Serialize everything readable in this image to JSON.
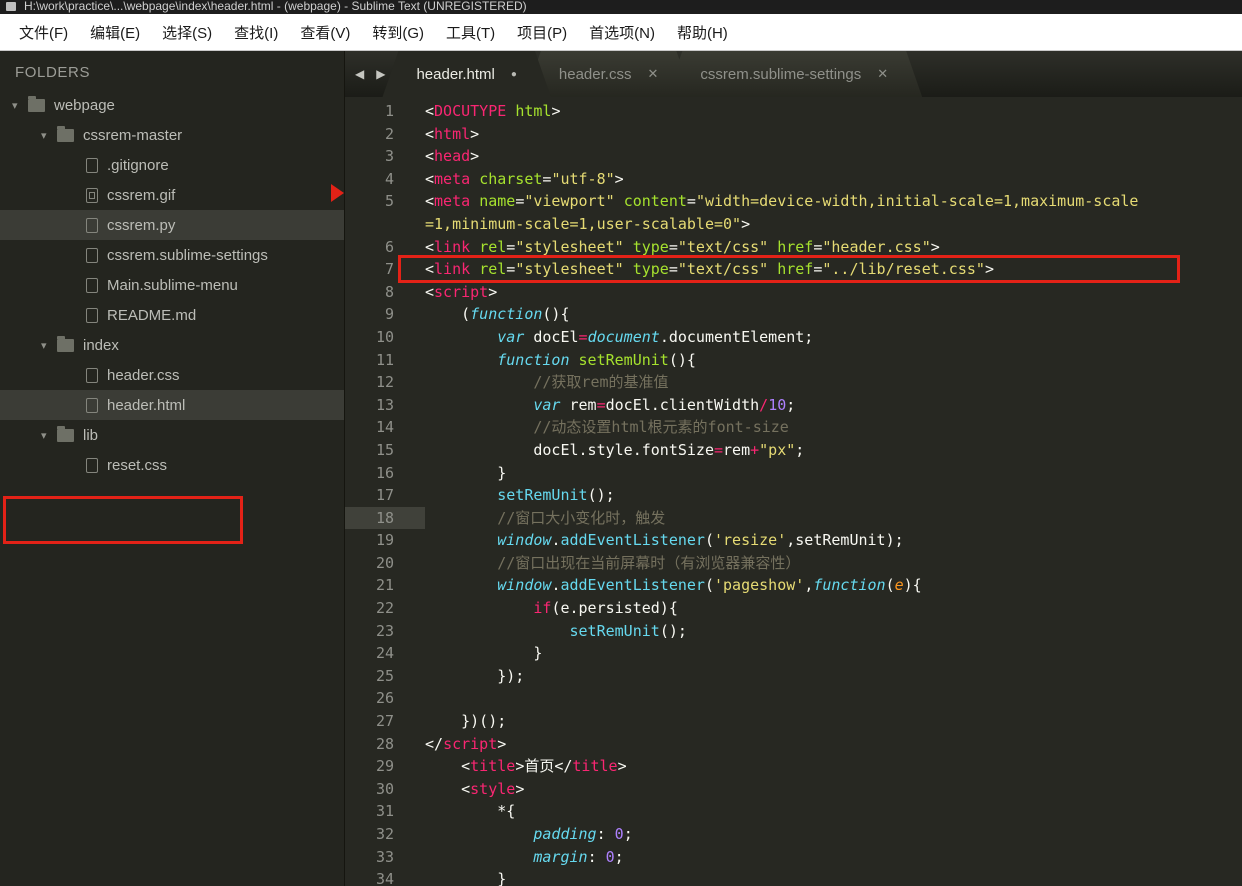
{
  "title_bar": {
    "title": "H:\\work\\practice\\...\\webpage\\index\\header.html - (webpage) - Sublime Text (UNREGISTERED)"
  },
  "menu": {
    "items": [
      "文件(F)",
      "编辑(E)",
      "选择(S)",
      "查找(I)",
      "查看(V)",
      "转到(G)",
      "工具(T)",
      "项目(P)",
      "首选项(N)",
      "帮助(H)"
    ]
  },
  "sidebar": {
    "heading": "FOLDERS",
    "tree": [
      {
        "label": "webpage",
        "type": "folder",
        "depth": 0,
        "expanded": true,
        "selected": false
      },
      {
        "label": "cssrem-master",
        "type": "folder",
        "depth": 1,
        "expanded": true,
        "selected": false
      },
      {
        "label": ".gitignore",
        "type": "file",
        "depth": 2,
        "selected": false
      },
      {
        "label": "cssrem.gif",
        "type": "image",
        "depth": 2,
        "selected": false
      },
      {
        "label": "cssrem.py",
        "type": "file",
        "depth": 2,
        "selected": true
      },
      {
        "label": "cssrem.sublime-settings",
        "type": "file",
        "depth": 2,
        "selected": false
      },
      {
        "label": "Main.sublime-menu",
        "type": "file",
        "depth": 2,
        "selected": false
      },
      {
        "label": "README.md",
        "type": "file",
        "depth": 2,
        "selected": false
      },
      {
        "label": "index",
        "type": "folder",
        "depth": 1,
        "expanded": true,
        "selected": false
      },
      {
        "label": "header.css",
        "type": "file",
        "depth": 2,
        "selected": false
      },
      {
        "label": "header.html",
        "type": "file",
        "depth": 2,
        "selected": true
      },
      {
        "label": "lib",
        "type": "folder",
        "depth": 1,
        "expanded": true,
        "selected": false
      },
      {
        "label": "reset.css",
        "type": "file",
        "depth": 2,
        "selected": false,
        "annotated": true
      }
    ]
  },
  "tabbar": {
    "nav_left": "◀",
    "nav_right": "▶",
    "tabs": [
      {
        "label": "header.html",
        "active": true,
        "modified": true,
        "closable": false
      },
      {
        "label": "header.css",
        "active": false,
        "modified": false,
        "closable": true
      },
      {
        "label": "cssrem.sublime-settings",
        "active": false,
        "modified": false,
        "closable": true
      }
    ]
  },
  "editor": {
    "rows": [
      {
        "num": "1",
        "t": [
          [
            "w",
            "<"
          ],
          [
            "t",
            "DOCUTYPE"
          ],
          [
            "w",
            " "
          ],
          [
            "a",
            "html"
          ],
          [
            "w",
            ">"
          ]
        ]
      },
      {
        "num": "2",
        "t": [
          [
            "w",
            "<"
          ],
          [
            "t",
            "html"
          ],
          [
            "w",
            ">"
          ]
        ]
      },
      {
        "num": "3",
        "t": [
          [
            "w",
            "<"
          ],
          [
            "t",
            "head"
          ],
          [
            "w",
            ">"
          ]
        ]
      },
      {
        "num": "4",
        "t": [
          [
            "w",
            "<"
          ],
          [
            "t",
            "meta"
          ],
          [
            "w",
            " "
          ],
          [
            "a",
            "charset"
          ],
          [
            "w",
            "="
          ],
          [
            "s",
            "\"utf-8\""
          ],
          [
            "w",
            ">"
          ]
        ]
      },
      {
        "num": "5",
        "t": [
          [
            "w",
            "<"
          ],
          [
            "t",
            "meta"
          ],
          [
            "w",
            " "
          ],
          [
            "a",
            "name"
          ],
          [
            "w",
            "="
          ],
          [
            "s",
            "\"viewport\""
          ],
          [
            "w",
            " "
          ],
          [
            "a",
            "content"
          ],
          [
            "w",
            "="
          ],
          [
            "s",
            "\"width=device-width,initial-scale=1,maximum-scale"
          ]
        ]
      },
      {
        "num": "",
        "t": [
          [
            "s",
            "=1,minimum-scale=1,user-scalable=0\""
          ],
          [
            "w",
            ">"
          ]
        ]
      },
      {
        "num": "6",
        "t": [
          [
            "w",
            "<"
          ],
          [
            "t",
            "link"
          ],
          [
            "w",
            " "
          ],
          [
            "a",
            "rel"
          ],
          [
            "w",
            "="
          ],
          [
            "s",
            "\"stylesheet\""
          ],
          [
            "w",
            " "
          ],
          [
            "a",
            "type"
          ],
          [
            "w",
            "="
          ],
          [
            "s",
            "\"text/css\""
          ],
          [
            "w",
            " "
          ],
          [
            "a",
            "href"
          ],
          [
            "w",
            "="
          ],
          [
            "s",
            "\"header.css\""
          ],
          [
            "w",
            ">"
          ]
        ]
      },
      {
        "num": "7",
        "t": [
          [
            "w",
            "<"
          ],
          [
            "t",
            "link"
          ],
          [
            "w",
            " "
          ],
          [
            "a",
            "rel"
          ],
          [
            "w",
            "="
          ],
          [
            "s",
            "\"stylesheet\""
          ],
          [
            "w",
            " "
          ],
          [
            "a",
            "type"
          ],
          [
            "w",
            "="
          ],
          [
            "s",
            "\"text/css\""
          ],
          [
            "w",
            " "
          ],
          [
            "a",
            "href"
          ],
          [
            "w",
            "="
          ],
          [
            "s",
            "\"../lib/reset.css\""
          ],
          [
            "w",
            ">"
          ]
        ]
      },
      {
        "num": "8",
        "t": [
          [
            "w",
            "<"
          ],
          [
            "t",
            "script"
          ],
          [
            "w",
            ">"
          ]
        ]
      },
      {
        "num": "9",
        "t": [
          [
            "w",
            "    ("
          ],
          [
            "k",
            "function"
          ],
          [
            "w",
            "(){"
          ]
        ]
      },
      {
        "num": "10",
        "t": [
          [
            "w",
            "        "
          ],
          [
            "k",
            "var"
          ],
          [
            "w",
            " docEl"
          ],
          [
            "o",
            "="
          ],
          [
            "k",
            "document"
          ],
          [
            "w",
            ".documentElement;"
          ]
        ]
      },
      {
        "num": "11",
        "t": [
          [
            "w",
            "        "
          ],
          [
            "k",
            "function"
          ],
          [
            "w",
            " "
          ],
          [
            "f",
            "setRemUnit"
          ],
          [
            "w",
            "(){"
          ]
        ]
      },
      {
        "num": "12",
        "t": [
          [
            "w",
            "            "
          ],
          [
            "c",
            "//获取rem的基准值"
          ]
        ]
      },
      {
        "num": "13",
        "t": [
          [
            "w",
            "            "
          ],
          [
            "k",
            "var"
          ],
          [
            "w",
            " rem"
          ],
          [
            "o",
            "="
          ],
          [
            "w",
            "docEl.clientWidth"
          ],
          [
            "o",
            "/"
          ],
          [
            "n",
            "10"
          ],
          [
            "w",
            ";"
          ]
        ]
      },
      {
        "num": "14",
        "t": [
          [
            "w",
            "            "
          ],
          [
            "c",
            "//动态设置html根元素的font-size"
          ]
        ]
      },
      {
        "num": "15",
        "t": [
          [
            "w",
            "            docEl.style.fontSize"
          ],
          [
            "o",
            "="
          ],
          [
            "w",
            "rem"
          ],
          [
            "o",
            "+"
          ],
          [
            "s",
            "\"px\""
          ],
          [
            "w",
            ";"
          ]
        ]
      },
      {
        "num": "16",
        "t": [
          [
            "w",
            "        }"
          ]
        ]
      },
      {
        "num": "17",
        "t": [
          [
            "w",
            "        "
          ],
          [
            "fc",
            "setRemUnit"
          ],
          [
            "w",
            "();"
          ]
        ]
      },
      {
        "num": "18",
        "hl": true,
        "t": [
          [
            "w",
            "        "
          ],
          [
            "c",
            "//窗口大小变化时，触发"
          ]
        ]
      },
      {
        "num": "19",
        "t": [
          [
            "w",
            "        "
          ],
          [
            "k",
            "window"
          ],
          [
            "w",
            "."
          ],
          [
            "fc",
            "addEventListener"
          ],
          [
            "w",
            "("
          ],
          [
            "s",
            "'resize'"
          ],
          [
            "w",
            ",setRemUnit);"
          ]
        ]
      },
      {
        "num": "20",
        "t": [
          [
            "w",
            "        "
          ],
          [
            "c",
            "//窗口出现在当前屏幕时（有浏览器兼容性）"
          ]
        ]
      },
      {
        "num": "21",
        "t": [
          [
            "w",
            "        "
          ],
          [
            "k",
            "window"
          ],
          [
            "w",
            "."
          ],
          [
            "fc",
            "addEventListener"
          ],
          [
            "w",
            "("
          ],
          [
            "s",
            "'pageshow'"
          ],
          [
            "w",
            ","
          ],
          [
            "k",
            "function"
          ],
          [
            "w",
            "("
          ],
          [
            "p",
            "e"
          ],
          [
            "w",
            "){"
          ]
        ]
      },
      {
        "num": "22",
        "t": [
          [
            "w",
            "            "
          ],
          [
            "o",
            "if"
          ],
          [
            "w",
            "(e.persisted){"
          ]
        ]
      },
      {
        "num": "23",
        "t": [
          [
            "w",
            "                "
          ],
          [
            "fc",
            "setRemUnit"
          ],
          [
            "w",
            "();"
          ]
        ]
      },
      {
        "num": "24",
        "t": [
          [
            "w",
            "            }"
          ]
        ]
      },
      {
        "num": "25",
        "t": [
          [
            "w",
            "        });"
          ]
        ]
      },
      {
        "num": "26",
        "t": []
      },
      {
        "num": "27",
        "t": [
          [
            "w",
            "    })();"
          ]
        ]
      },
      {
        "num": "28",
        "t": [
          [
            "w",
            "</"
          ],
          [
            "t",
            "script"
          ],
          [
            "w",
            ">"
          ]
        ]
      },
      {
        "num": "29",
        "t": [
          [
            "w",
            "    <"
          ],
          [
            "t",
            "title"
          ],
          [
            "w",
            ">首页</"
          ],
          [
            "t",
            "title"
          ],
          [
            "w",
            ">"
          ]
        ]
      },
      {
        "num": "30",
        "t": [
          [
            "w",
            "    <"
          ],
          [
            "t",
            "style"
          ],
          [
            "w",
            ">"
          ]
        ]
      },
      {
        "num": "31",
        "t": [
          [
            "w",
            "        *{"
          ]
        ]
      },
      {
        "num": "32",
        "t": [
          [
            "w",
            "            "
          ],
          [
            "k",
            "padding"
          ],
          [
            "w",
            ": "
          ],
          [
            "n",
            "0"
          ],
          [
            "w",
            ";"
          ]
        ]
      },
      {
        "num": "33",
        "t": [
          [
            "w",
            "            "
          ],
          [
            "k",
            "margin"
          ],
          [
            "w",
            ": "
          ],
          [
            "n",
            "0"
          ],
          [
            "w",
            ";"
          ]
        ]
      },
      {
        "num": "34",
        "t": [
          [
            "w",
            "        }"
          ]
        ]
      }
    ]
  }
}
